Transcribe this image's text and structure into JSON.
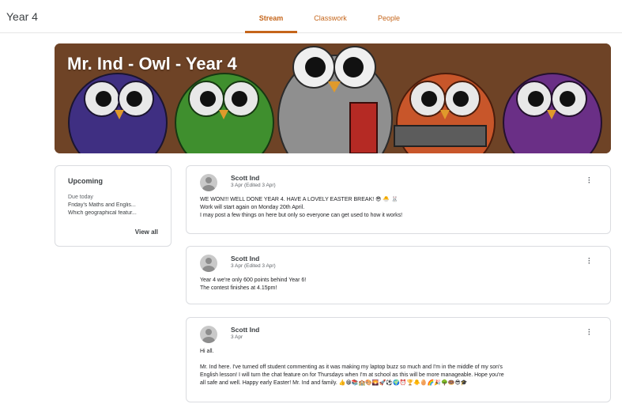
{
  "header": {
    "class_name": "Year 4",
    "tabs": [
      {
        "label": "Stream",
        "active": true
      },
      {
        "label": "Classwork",
        "active": false
      },
      {
        "label": "People",
        "active": false
      }
    ]
  },
  "banner": {
    "title": "Mr. Ind - Owl - Year 4"
  },
  "upcoming": {
    "title": "Upcoming",
    "due_label": "Due today",
    "items": [
      "Friday's Maths and Englis...",
      "Which geographical featur..."
    ],
    "view_all": "View all"
  },
  "posts": [
    {
      "author": "Scott Ind",
      "meta": "3 Apr (Edited 3 Apr)",
      "lines": [
        "WE WON!!! WELL DONE YEAR 4. HAVE A LOVELY EASTER BREAK! 😎 🐣 🐰",
        "Work will start again on Monday 20th April.",
        "I may post a few things on here but only so everyone can get used to how it works!"
      ]
    },
    {
      "author": "Scott Ind",
      "meta": "3 Apr (Edited 3 Apr)",
      "lines": [
        "Year 4 we're only 600 points behind Year 6!",
        "The contest finishes at 4.15pm!"
      ]
    },
    {
      "author": "Scott Ind",
      "meta": "3 Apr",
      "lines": [
        "Hi all.",
        "",
        "Mr. Ind here. I've turned off student commenting as it was making my laptop buzz so much and I'm in the middle of my son's",
        "English lesson! I will turn the chat feature on for Thursdays when I'm at school as this will be more manageable. Hope you're",
        "all safe and well. Happy early Easter! Mr. Ind and family. 👍😁📚🏫🎨🌄🚀⚽🌍⏰🏆🐥🥚🌈🎉🌳🍩😎🎓"
      ]
    }
  ],
  "colors": {
    "accent": "#c5651a",
    "banner_bg": "#6e4326"
  }
}
